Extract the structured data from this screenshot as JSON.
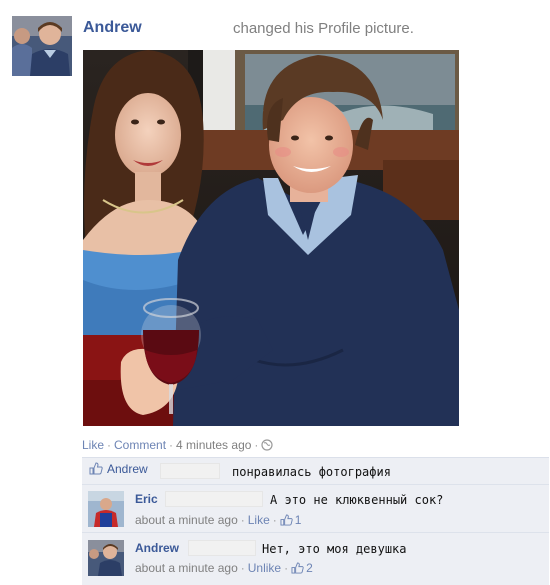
{
  "story": {
    "author": "Andrew",
    "action": "changed his Profile picture."
  },
  "meta": {
    "like": "Like",
    "comment": "Comment",
    "time": "4 minutes ago",
    "globe_icon": "globe-icon"
  },
  "likes_row": {
    "name": "Andrew",
    "text": "понравилась фотография"
  },
  "comments": [
    {
      "name": "Eric",
      "text": "А это не клюквенный сок?",
      "time": "about a minute ago",
      "action": "Like",
      "likes": "1"
    },
    {
      "name": "Andrew",
      "text": "Нет, это моя девушка",
      "time": "about a minute ago",
      "action": "Unlike",
      "likes": "2"
    }
  ],
  "colors": {
    "link": "#3b5998",
    "muted_link": "#6d84b4",
    "gray_text": "#808080",
    "comment_bg": "#edeff4"
  }
}
